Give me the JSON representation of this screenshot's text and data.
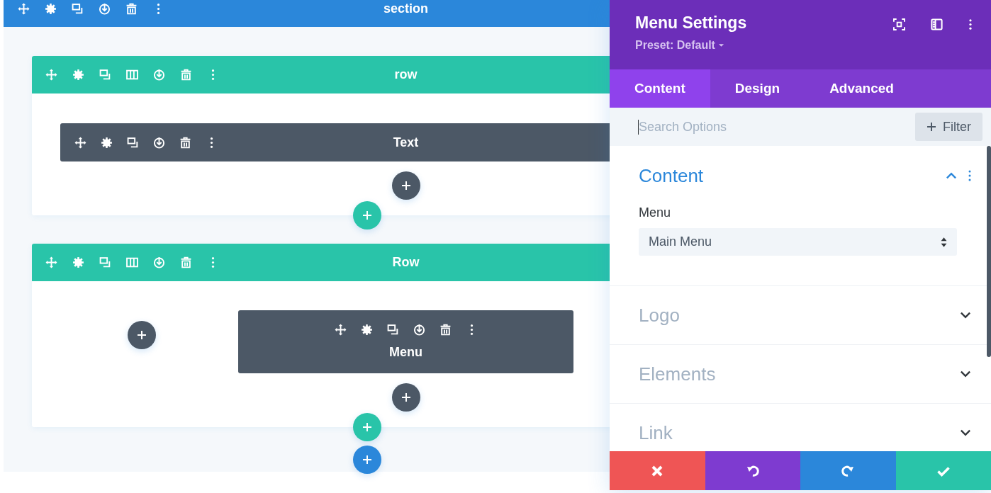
{
  "section": {
    "label": "section"
  },
  "rows": [
    {
      "label": "row",
      "kind": "single",
      "modules": [
        {
          "label": "Text",
          "kind": "wide"
        }
      ]
    },
    {
      "label": "Row",
      "kind": "split",
      "modules": [
        {
          "label": "Menu",
          "kind": "stacked"
        }
      ]
    }
  ],
  "panel": {
    "title": "Menu Settings",
    "preset": "Preset: Default",
    "tabs": [
      {
        "label": "Content",
        "selected": true
      },
      {
        "label": "Design",
        "selected": false
      },
      {
        "label": "Advanced",
        "selected": false
      }
    ],
    "search": {
      "placeholder": "Search Options"
    },
    "filter_button": "Filter",
    "groups": [
      {
        "title": "Content",
        "expanded": true,
        "fields": [
          {
            "label": "Menu",
            "value": "Main Menu"
          }
        ]
      },
      {
        "title": "Logo",
        "expanded": false
      },
      {
        "title": "Elements",
        "expanded": false
      },
      {
        "title": "Link",
        "expanded": false
      }
    ],
    "footer": [
      {
        "kind": "discard"
      },
      {
        "kind": "undo"
      },
      {
        "kind": "redo"
      },
      {
        "kind": "save"
      }
    ]
  }
}
